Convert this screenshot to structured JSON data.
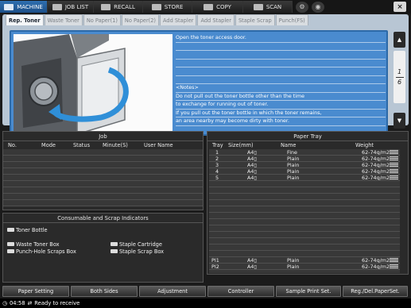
{
  "top_bar": {
    "modes": [
      {
        "label": "MACHINE",
        "icon": "machine-icon",
        "active": true
      },
      {
        "label": "JOB LIST",
        "icon": "job-list-icon",
        "active": false
      },
      {
        "label": "RECALL",
        "icon": "recall-icon",
        "active": false
      },
      {
        "label": "STORE",
        "icon": "store-icon",
        "active": false
      },
      {
        "label": "COPY",
        "icon": "copy-icon",
        "active": false
      },
      {
        "label": "SCAN",
        "icon": "scan-icon",
        "active": false
      }
    ],
    "close_label": "×"
  },
  "tabs": [
    "Rep. Toner",
    "Waste Toner",
    "No Paper(1)",
    "No Paper(2)",
    "Add Stapler",
    "Add Stapler",
    "Staple Scrap",
    "Punch(FS)"
  ],
  "guidance": {
    "lines": [
      "Open the toner access door.",
      "",
      "",
      "",
      "",
      "",
      "<Notes>",
      "Do not pull out the toner bottle other than the time",
      "to exchange for running out of toner.",
      "If you pull out the toner bottle in which the toner remains,",
      "an area nearby may become dirty with toner."
    ],
    "page_current": "1",
    "page_total": "6",
    "scroll_up": "▲",
    "scroll_down": "▼"
  },
  "job": {
    "title": "Job",
    "headers": [
      "No.",
      "Mode",
      "Status",
      "Minute(S)",
      "User Name"
    ]
  },
  "consumables": {
    "title": "Consumable and Scrap Indicators",
    "toner": "Toner Bottle",
    "waste": "Waste Toner Box",
    "punch": "Punch-Hole Scraps Box",
    "cartridge": "Staple Cartridge",
    "scrap": "Staple Scrap Box"
  },
  "paper_tray": {
    "title": "Paper Tray",
    "headers": [
      "Tray",
      "Size(mm)",
      "Name",
      "Weight"
    ],
    "rows": [
      {
        "tray": "1",
        "size": "A4▯",
        "name": "Fine",
        "weight": "62-74g/m2"
      },
      {
        "tray": "2",
        "size": "A4▯",
        "name": "Plain",
        "weight": "62-74g/m2"
      },
      {
        "tray": "3",
        "size": "A4▯",
        "name": "Plain",
        "weight": "62-74g/m2"
      },
      {
        "tray": "4",
        "size": "A4▯",
        "name": "Plain",
        "weight": "62-74g/m2"
      },
      {
        "tray": "5",
        "size": "A4▯",
        "name": "Plain",
        "weight": "62-74g/m2"
      }
    ],
    "pi_rows": [
      {
        "tray": "PI1",
        "size": "A4▯",
        "name": "Plain",
        "weight": "62-74g/m2"
      },
      {
        "tray": "PI2",
        "size": "A4▯",
        "name": "Plain",
        "weight": "62-74g/m2"
      }
    ]
  },
  "bottom_buttons": [
    "Paper Setting",
    "Both Sides",
    "Adjustment",
    "Controller",
    "Sample Print Set.",
    "Reg./Del.PaperSet."
  ],
  "status": {
    "time": "04:58",
    "message": "Ready to receive"
  }
}
